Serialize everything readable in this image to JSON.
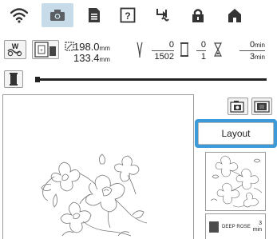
{
  "toolbar": {
    "icons": [
      "wifi-icon",
      "camera-icon",
      "document-icon",
      "help-icon",
      "embroidery-icon",
      "home-icon",
      "needle-mode-icon"
    ],
    "active": "camera-icon"
  },
  "info": {
    "width_value": "198.0",
    "width_unit": "mm",
    "height_value": "133.4",
    "height_unit": "mm",
    "stitch_current": "0",
    "stitch_total": "1502",
    "color_current": "0",
    "color_total": "1",
    "time_current": "0",
    "time_current_unit": "min",
    "time_total": "3",
    "time_total_unit": "min"
  },
  "progress": {
    "value": 0.02
  },
  "buttons": {
    "layout_label": "Layout"
  },
  "thread": {
    "name": "DEEP ROSE",
    "time_value": "3",
    "time_unit": "min",
    "color": "#4c4c4c"
  },
  "colors": {
    "accent": "#3d9ad8",
    "active_tab_bg": "#c7dbe9"
  }
}
